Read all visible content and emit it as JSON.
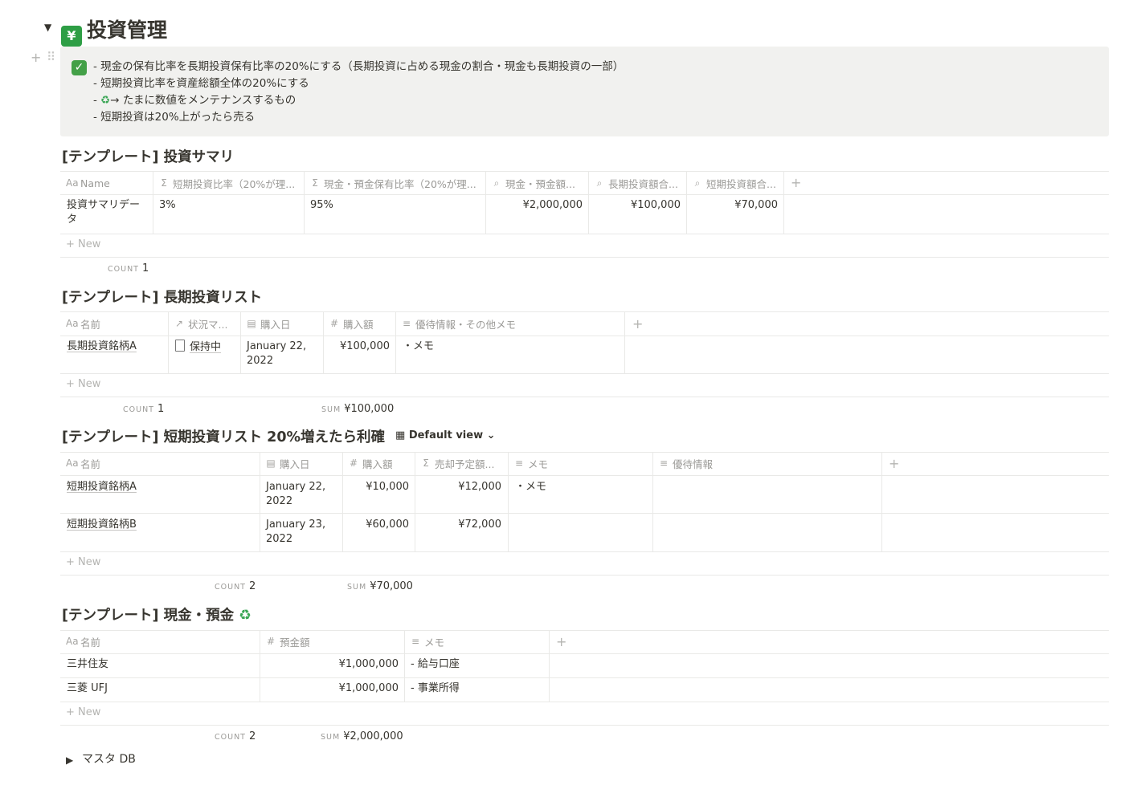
{
  "page": {
    "title": "投資管理",
    "title_icon": "chart-yen-icon"
  },
  "callout": {
    "lines": [
      "- 現金の保有比率を長期投資保有比率の20%にする（長期投資に占める現金の割合・現金も長期投資の一部）",
      "- 短期投資比率を資産総額全体の20%にする",
      "→ たまに数値をメンテナンスするもの",
      "- 短期投資は20%上がったら売る"
    ],
    "line3_prefix": "- "
  },
  "summary": {
    "title": "[テンプレート] 投資サマリ",
    "headers": [
      "Name",
      "短期投資比率（20%が理...",
      "現金・預金保有比率（20%が理...",
      "現金・預金額...",
      "長期投資額合...",
      "短期投資額合..."
    ],
    "row": [
      "投資サマリデー",
      "タ",
      "3%",
      "95%",
      "¥2,000,000",
      "¥100,000",
      "¥70,000"
    ],
    "new_label": "New",
    "count_label": "COUNT",
    "count": "1"
  },
  "long_term": {
    "title": "[テンプレート] 長期投資リスト",
    "headers": [
      "名前",
      "状況マ...",
      "購入日",
      "購入額",
      "優待情報・その他メモ"
    ],
    "row": {
      "name": "長期投資銘柄A",
      "status": "保持中",
      "date1": "January 22,",
      "date2": "2022",
      "amount": "¥100,000",
      "memo": "・メモ"
    },
    "new_label": "New",
    "count_label": "COUNT",
    "count": "1",
    "sum_label": "SUM",
    "sum": "¥100,000"
  },
  "short_term": {
    "title": "[テンプレート] 短期投資リスト 20%増えたら利確",
    "view_label": "Default view",
    "headers": [
      "名前",
      "購入日",
      "購入額",
      "売却予定額...",
      "メモ",
      "優待情報"
    ],
    "rows": [
      {
        "name": "短期投資銘柄A",
        "date1": "January 22,",
        "date2": "2022",
        "amount": "¥10,000",
        "sell": "¥12,000",
        "memo": "・メモ"
      },
      {
        "name": "短期投資銘柄B",
        "date1": "January 23,",
        "date2": "2022",
        "amount": "¥60,000",
        "sell": "¥72,000",
        "memo": ""
      }
    ],
    "new_label": "New",
    "count_label": "COUNT",
    "count": "2",
    "sum_label": "SUM",
    "sum": "¥70,000"
  },
  "cash": {
    "title": "[テンプレート] 現金・預金",
    "headers": [
      "名前",
      "預金額",
      "メモ"
    ],
    "rows": [
      {
        "name": "三井住友",
        "amount": "¥1,000,000",
        "memo": "- 給与口座"
      },
      {
        "name": "三菱 UFJ",
        "amount": "¥1,000,000",
        "memo": "- 事業所得"
      }
    ],
    "new_label": "New",
    "count_label": "COUNT",
    "count": "2",
    "sum_label": "SUM",
    "sum": "¥2,000,000"
  },
  "master": {
    "label": "マスタ DB"
  }
}
